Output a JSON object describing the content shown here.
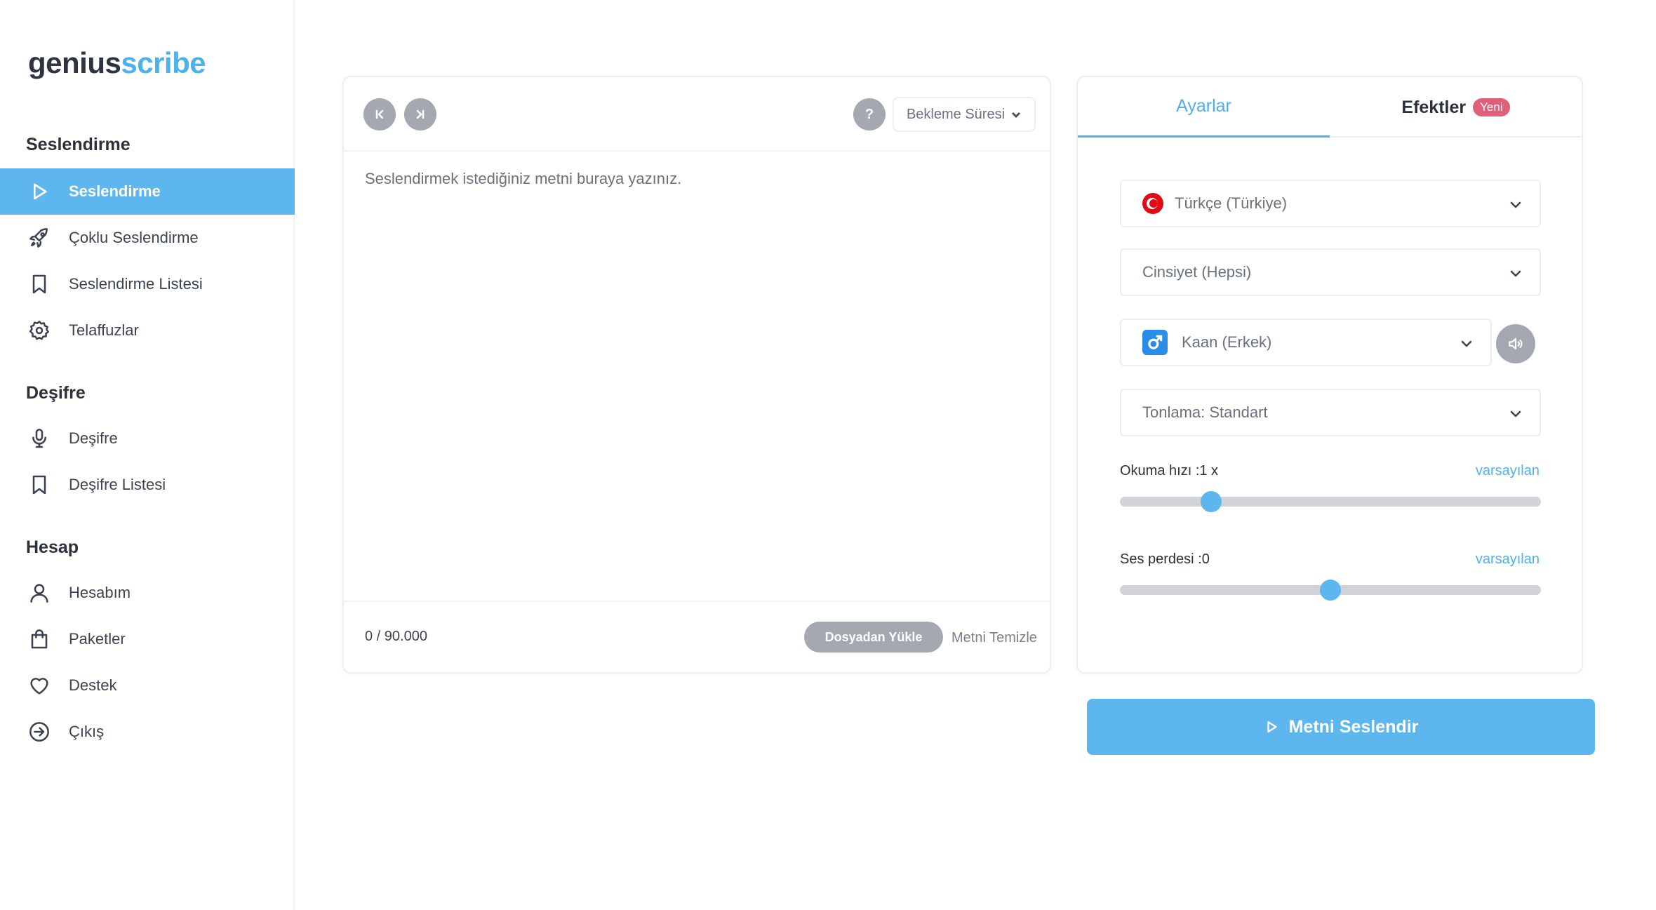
{
  "logo": {
    "part1": "genius",
    "part2": "scribe"
  },
  "sidebar": {
    "sections": [
      {
        "title": "Seslendirme"
      },
      {
        "title": "Deşifre"
      },
      {
        "title": "Hesap"
      }
    ],
    "items": [
      {
        "label": "Seslendirme",
        "icon": "play-icon"
      },
      {
        "label": "Çoklu Seslendirme",
        "icon": "rocket-icon"
      },
      {
        "label": "Seslendirme Listesi",
        "icon": "bookmark-icon"
      },
      {
        "label": "Telaffuzlar",
        "icon": "gear-icon"
      },
      {
        "label": "Deşifre",
        "icon": "microphone-icon"
      },
      {
        "label": "Deşifre Listesi",
        "icon": "bookmark-icon"
      },
      {
        "label": "Hesabım",
        "icon": "user-icon"
      },
      {
        "label": "Paketler",
        "icon": "shopping-bag-icon"
      },
      {
        "label": "Destek",
        "icon": "heart-icon"
      },
      {
        "label": "Çıkış",
        "icon": "logout-icon"
      }
    ]
  },
  "editor": {
    "help_label": "?",
    "wait_label": "Bekleme Süresi",
    "placeholder": "Seslendirmek istediğiniz metni buraya yazınız.",
    "counter": "0 / 90.000",
    "upload_label": "Dosyadan Yükle",
    "clear_label": "Metni Temizle"
  },
  "settings": {
    "tabs": {
      "settings": "Ayarlar",
      "effects": "Efektler",
      "new_badge": "Yeni"
    },
    "language": "Türkçe (Türkiye)",
    "gender": "Cinsiyet (Hepsi)",
    "voice": "Kaan (Erkek)",
    "intonation": "Tonlama: Standart",
    "speed_label": "Okuma hızı :1 x",
    "pitch_label": "Ses perdesi :0",
    "default_label": "varsayılan",
    "speed_fraction": 0.217,
    "pitch_fraction": 0.5
  },
  "speak_button": "Metni Seslendir",
  "colors": {
    "accent": "#5db6ee",
    "badge": "#e0607a",
    "muted_button": "#a4a8b1"
  }
}
